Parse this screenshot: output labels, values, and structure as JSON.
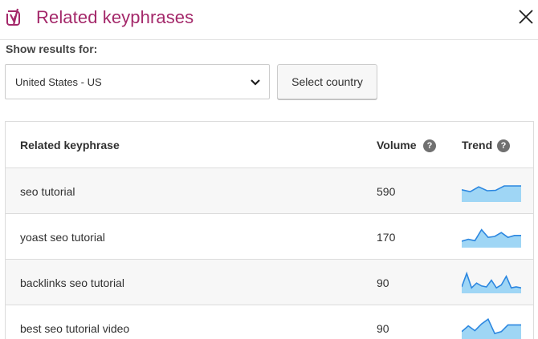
{
  "modal": {
    "title": "Related keyphrases",
    "logo_icon": "yoast-logo-icon",
    "close_icon": "close-icon",
    "brand_color": "#a4286a"
  },
  "filters": {
    "show_results_label": "Show results for:",
    "country_selected": "United States - US",
    "select_country_label": "Select country"
  },
  "table": {
    "headers": {
      "keyphrase": "Related keyphrase",
      "volume": "Volume",
      "trend": "Trend",
      "help_glyph": "?"
    },
    "rows": [
      {
        "keyphrase": "seo tutorial",
        "volume": "590",
        "trend": [
          0.55,
          0.45,
          0.7,
          0.5,
          0.52,
          0.75,
          0.75,
          0.75
        ]
      },
      {
        "keyphrase": "yoast seo tutorial",
        "volume": "170",
        "trend": [
          0.25,
          0.35,
          0.28,
          0.85,
          0.45,
          0.5,
          0.7,
          0.45,
          0.55,
          0.55
        ]
      },
      {
        "keyphrase": "backlinks seo tutorial",
        "volume": "90",
        "trend": [
          0.25,
          0.95,
          0.2,
          0.45,
          0.3,
          0.25,
          0.6,
          0.2,
          0.35,
          0.8,
          0.2,
          0.25,
          0.2
        ]
      },
      {
        "keyphrase": "best seo tutorial video",
        "volume": "90",
        "trend": [
          0.3,
          0.6,
          0.35,
          0.7,
          0.95,
          0.2,
          0.3,
          0.65,
          0.65,
          0.65
        ]
      }
    ],
    "trend_line_color": "#2c87e0",
    "trend_fill_color": "#9fd6f5"
  }
}
